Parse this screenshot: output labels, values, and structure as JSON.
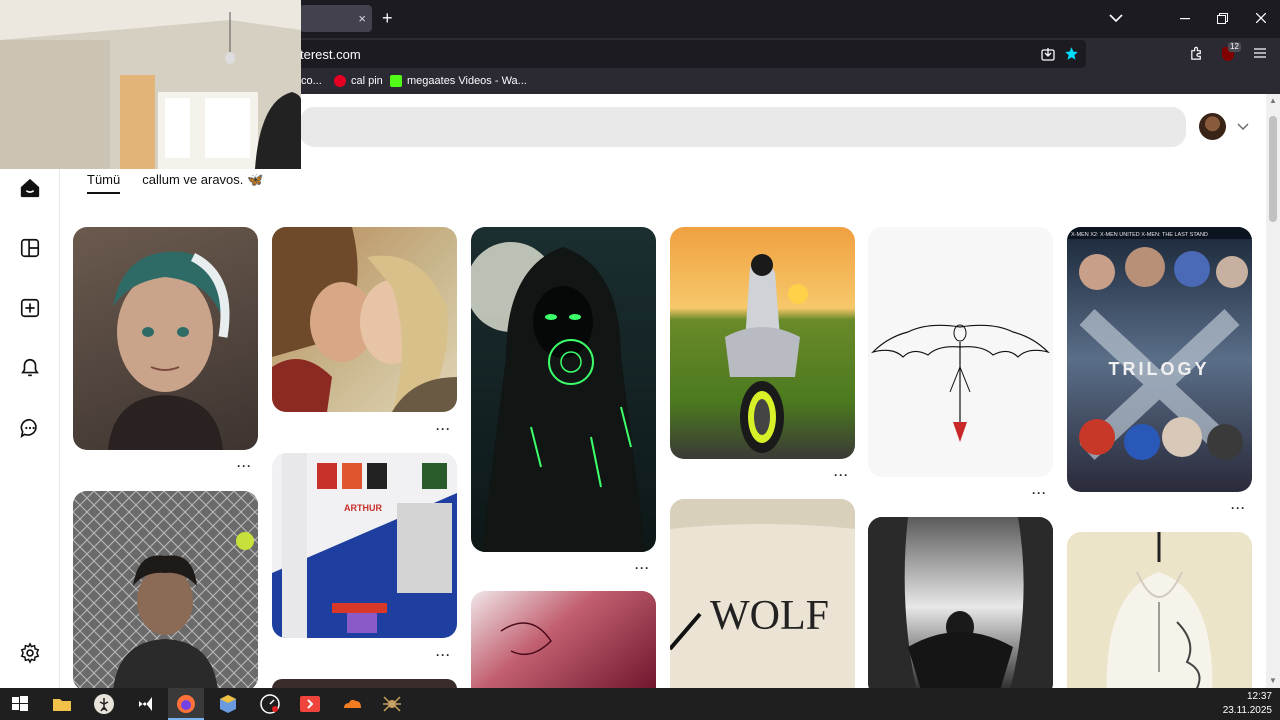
{
  "browser": {
    "tab": {
      "close_glyph": "×"
    },
    "new_tab_glyph": "+",
    "url": "terest.com",
    "bookmarks": [
      {
        "label": "co..."
      },
      {
        "label": "cal pin",
        "icon": "pinterest-icon"
      },
      {
        "label": "megaates Videos - Wa...",
        "icon": "green-k-icon"
      }
    ],
    "extension_badge": "12"
  },
  "page": {
    "filters": [
      "Tümü",
      "callum ve aravos. 🦋"
    ],
    "pins": [
      {
        "name": "pin-animated-man",
        "col": 0,
        "row": 0
      },
      {
        "name": "pin-kissing-couple",
        "col": 1,
        "row": 0
      },
      {
        "name": "pin-hooded-green-glow",
        "col": 2,
        "row": 0
      },
      {
        "name": "pin-motorcycle-sunset",
        "col": 3,
        "row": 0
      },
      {
        "name": "pin-dragon-sketch",
        "col": 4,
        "row": 0
      },
      {
        "name": "pin-xmen-trilogy",
        "col": 5,
        "row": 0,
        "text": "TRILOGY",
        "header": "X-MEN   X2: X-MEN UNITED   X-MEN: THE LAST STAND"
      },
      {
        "name": "pin-wrestler-cage",
        "col": 0,
        "row": 1
      },
      {
        "name": "pin-kids-room",
        "col": 1,
        "row": 1,
        "text": "ARTHUR"
      },
      {
        "name": "pin-red-abstract",
        "col": 2,
        "row": 1
      },
      {
        "name": "pin-wolf-sketch",
        "col": 3,
        "row": 1,
        "text": "WOLF"
      },
      {
        "name": "pin-dark-dragon",
        "col": 4,
        "row": 1
      },
      {
        "name": "pin-dragon-hoodie",
        "col": 5,
        "row": 1
      }
    ],
    "more_glyph": "···"
  },
  "taskbar": {
    "time": "12:37",
    "date": "23.11.2025"
  },
  "colors": {
    "chrome_dark": "#1c1b22",
    "chrome_mid": "#2b2a33",
    "accent_star": "#00ddff",
    "pinterest_red": "#e60023"
  }
}
